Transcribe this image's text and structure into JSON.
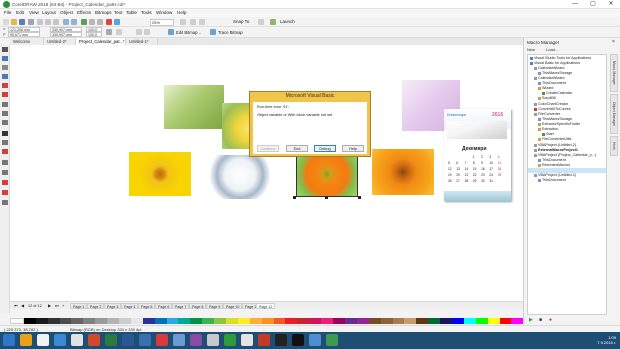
{
  "window": {
    "title": "CorelDRAW 2016 (64 Bit) - Project_Calendar_patH.cdr*",
    "minimize": "—",
    "maximize": "▢",
    "close": "✕"
  },
  "menu": [
    "File",
    "Edit",
    "View",
    "Layout",
    "Object",
    "Effects",
    "Bitmaps",
    "Text",
    "Table",
    "Tools",
    "Window",
    "Help"
  ],
  "toolbar": {
    "zoom": "25%",
    "snap_to": "Snap To",
    "launch": "Launch"
  },
  "propbar": {
    "x": "121,208 mm",
    "y": "95,671 mm",
    "w": "330,907 mm",
    "h": "330,907 mm",
    "scale_w": "100,0",
    "scale_h": "100,0",
    "edit_bitmap": "Edit Bitmap...",
    "trace_bitmap": "Trace Bitmap"
  },
  "tabs": [
    "Welcome Screen",
    "Untitled-2*",
    "Project_Calendar_pat...*",
    "Untitled-1*"
  ],
  "active_tab_index": 2,
  "page_tabs": {
    "counter": "12 of 12",
    "pages": [
      "Page 1",
      "Page 2",
      "Page 3",
      "Page 4",
      "Page 5",
      "Page 6",
      "Page 7",
      "Page 8",
      "Page 9",
      "Page 10",
      "Page 11",
      "Page 12"
    ],
    "active_index": 11
  },
  "status": {
    "coords": "( 225,373, 38,782 )",
    "object": "Bitmap (RGB) on Desktop 330 x 330 dpi"
  },
  "dialog": {
    "title": "Microsoft Visual Basic",
    "line1": "Run-time error '91':",
    "line2": "Object variable or With block variable not set",
    "buttons": [
      {
        "label": "Continue",
        "state": "disabled"
      },
      {
        "label": "End",
        "state": "normal"
      },
      {
        "label": "Debug",
        "state": "focused"
      },
      {
        "label": "Help",
        "state": "normal"
      }
    ]
  },
  "calendar": {
    "brand": "Dreamscape",
    "year": "2016",
    "month": "Декември",
    "rows": [
      [
        "",
        "",
        "",
        "1",
        "2",
        "3",
        "4"
      ],
      [
        "5",
        "6",
        "7",
        "8",
        "9",
        "10",
        "11"
      ],
      [
        "12",
        "13",
        "14",
        "15",
        "16",
        "17",
        "18"
      ],
      [
        "19",
        "20",
        "21",
        "22",
        "23",
        "24",
        "25"
      ],
      [
        "26",
        "27",
        "28",
        "29",
        "30",
        "31",
        ""
      ]
    ]
  },
  "macro_manager": {
    "title": "Macro Manager",
    "toolbar_new": "New",
    "toolbar_load": "Load...",
    "tree": [
      {
        "label": "Visual Studio Tools for Applications",
        "level": 0
      },
      {
        "label": "Visual Basic for Applications",
        "level": 0
      },
      {
        "label": "CalendarWizard",
        "level": 1
      },
      {
        "label": "ThisMacroStorage",
        "level": 2
      },
      {
        "label": "CalendarWizard",
        "level": 1
      },
      {
        "label": "ThisDocument",
        "level": 2
      },
      {
        "label": "Wizard",
        "level": 2
      },
      {
        "label": "CreateCalendar",
        "level": 3
      },
      {
        "label": "Scrp806",
        "level": 2
      },
      {
        "label": "ColorChartCreator",
        "level": 1
      },
      {
        "label": "ConvertAllToCurves",
        "level": 1
      },
      {
        "label": "FileConverter",
        "level": 1
      },
      {
        "label": "ThisMacroStorage",
        "level": 2
      },
      {
        "label": "ExtractorSpecificFolder",
        "level": 2
      },
      {
        "label": "Extraction",
        "level": 2
      },
      {
        "label": "Start",
        "level": 3
      },
      {
        "label": "FileConverterUtils",
        "level": 2
      },
      {
        "label": "VBAProject (Untitled-2)",
        "level": 1
      },
      {
        "label": "ExternalMacroProject1",
        "level": 1
      },
      {
        "label": "VBAProject (Project_Calendar_p...)",
        "level": 1
      },
      {
        "label": "ThisDocument",
        "level": 2
      },
      {
        "label": "RecordedMacros",
        "level": 2
      },
      {
        "label": "",
        "level": 2
      },
      {
        "label": "VBAProject (Untitled-1)",
        "level": 1
      },
      {
        "label": "ThisDocument",
        "level": 2
      }
    ],
    "selected_index": 22,
    "side_tabs": [
      "Macro Manager",
      "Object Manager",
      "Hints"
    ]
  },
  "taskbar": {
    "time": "1:05",
    "date": "7.9.2016 г."
  },
  "colors": {
    "accent": "#1f4e75",
    "dialog_frame": "#f0c54a",
    "selection": "#cce4f7"
  }
}
